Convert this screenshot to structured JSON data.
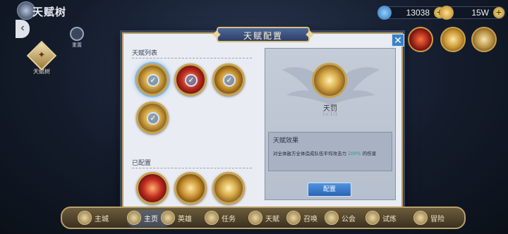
{
  "topbar": {
    "title": "天赋树",
    "gem_value": "13038",
    "gold_value": "15W"
  },
  "sidebar": {
    "reset_label": "重置",
    "tree_tab_label": "天赋树"
  },
  "modal": {
    "title": "天赋配置",
    "list_title": "天赋列表",
    "configured_title": "已配置",
    "detail": {
      "name": "天罚",
      "level": "Lv.1/1",
      "effect_title": "天赋效果",
      "effect_prefix": "对全体敌方全体造成队伍平均攻击力",
      "effect_percent": "200%",
      "effect_suffix": "的伤害",
      "config_button": "配置"
    }
  },
  "bottom_nav": {
    "items": [
      {
        "label": "主城"
      },
      {
        "label": "主页"
      },
      {
        "label": "英雄"
      },
      {
        "label": "任务"
      },
      {
        "label": "天赋"
      },
      {
        "label": "召唤"
      },
      {
        "label": "公会"
      },
      {
        "label": "试炼"
      },
      {
        "label": "冒险"
      }
    ]
  },
  "colors": {
    "accent_gold": "#c9a24c",
    "button_blue": "#3b82c4",
    "effect_green": "#2a9a7a"
  }
}
